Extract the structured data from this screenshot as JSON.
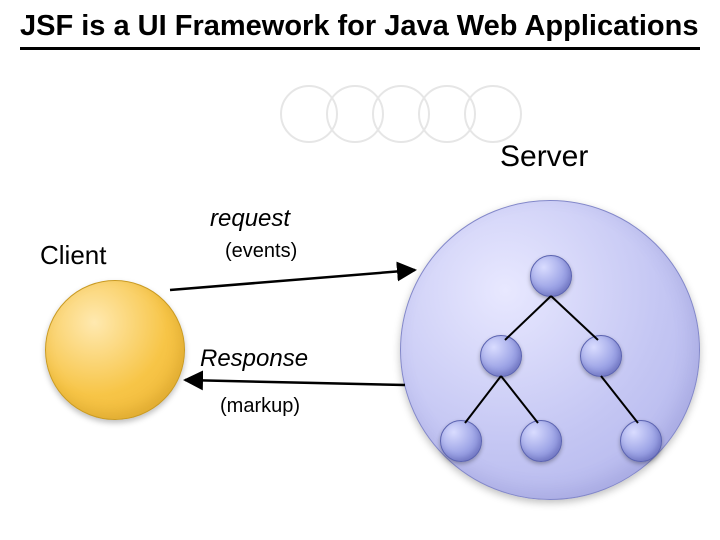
{
  "title": "JSF is a UI Framework for Java Web Applications",
  "labels": {
    "server": "Server",
    "client": "Client",
    "ui": "UI",
    "request": "request",
    "events": "(events)",
    "response": "Response",
    "markup": "(markup)"
  },
  "diagram": {
    "client_node": {
      "shape": "circle",
      "color": "#f7c547"
    },
    "server_node": {
      "shape": "circle",
      "color": "#c4c6f3"
    },
    "ui_tree": {
      "root": {},
      "children": [
        {
          "children": [
            {},
            {}
          ]
        },
        {
          "children": [
            {}
          ]
        }
      ]
    },
    "arrows": [
      {
        "from": "client",
        "to": "server",
        "label": "request",
        "sublabel": "(events)"
      },
      {
        "from": "server",
        "to": "client",
        "label": "Response",
        "sublabel": "(markup)"
      }
    ]
  }
}
